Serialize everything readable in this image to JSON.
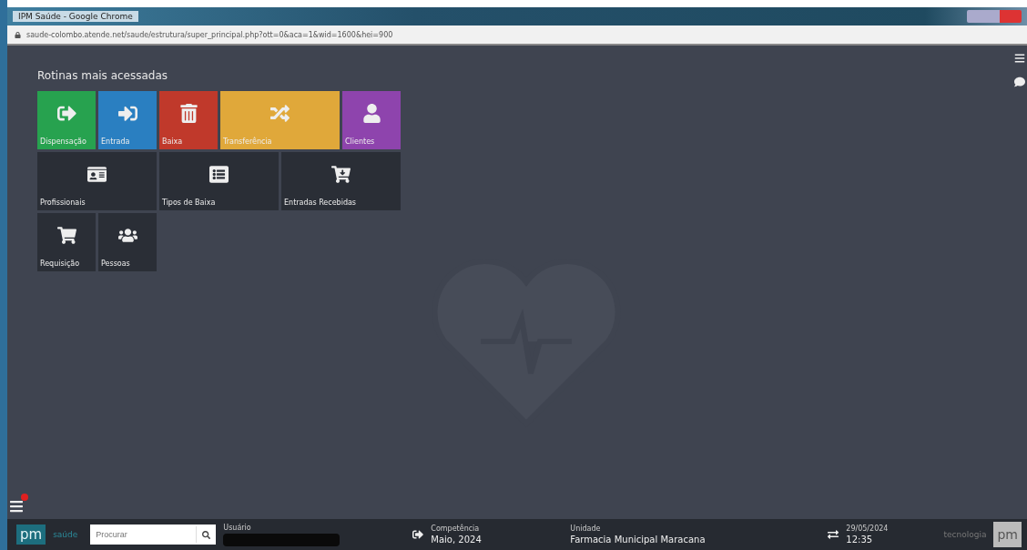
{
  "window": {
    "title": "IPM Saúde - Google Chrome",
    "url": "saude-colombo.atende.net/saude/estrutura/super_principal.php?ott=0&aca=1&wid=1600&hei=900"
  },
  "section_title": "Rotinas mais acessadas",
  "tile_rows": [
    {
      "tiles": [
        {
          "label": "Dispensação",
          "kind": "square",
          "color": "#27a24f"
        },
        {
          "label": "Entrada",
          "kind": "square",
          "color": "#2a7fc1"
        },
        {
          "label": "Baixa",
          "kind": "square",
          "color": "#c0392b"
        },
        {
          "label": "Transferência",
          "kind": "wide",
          "color": "#e0a83a"
        },
        {
          "label": "Clientes",
          "kind": "square",
          "color": "#8e44ad"
        }
      ]
    },
    {
      "tiles": [
        {
          "label": "Profissionais",
          "kind": "wide",
          "color": "#2a2e36"
        },
        {
          "label": "Tipos de Baixa",
          "kind": "wide",
          "color": "#2a2e36"
        },
        {
          "label": "Entradas Recebidas",
          "kind": "wide",
          "color": "#2a2e36"
        }
      ]
    },
    {
      "tiles": [
        {
          "label": "Requisição",
          "kind": "square",
          "color": "#2a2e36"
        },
        {
          "label": "Pessoas",
          "kind": "square",
          "color": "#2a2e36"
        }
      ]
    }
  ],
  "menu": {
    "has_notification": true
  },
  "status_bar": {
    "logo": "pm",
    "logo_suffix": "saúde",
    "search": {
      "placeholder": "Procurar"
    },
    "user": {
      "label": "Usuário"
    },
    "competence": {
      "label": "Competência",
      "value": "Maio, 2024"
    },
    "unit": {
      "label": "Unidade",
      "value": "Farmacia Municipal Maracana"
    },
    "date": "29/05/2024",
    "time": "12:35",
    "brand_text": "tecnologia",
    "brand_logo": "pm"
  }
}
